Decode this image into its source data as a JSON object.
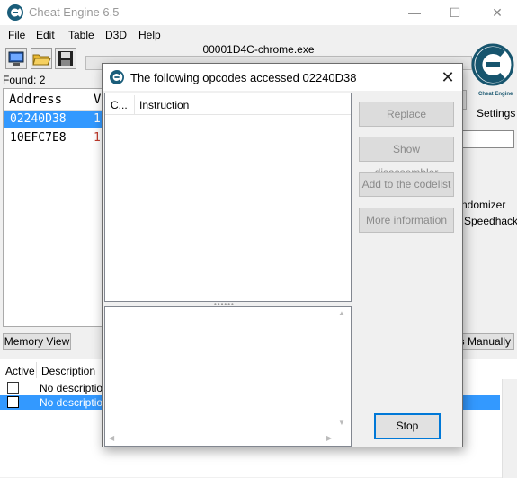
{
  "main_window": {
    "title": "Cheat Engine 6.5",
    "minimize_glyph": "—",
    "maximize_glyph": "☐",
    "close_glyph": "✕",
    "menu": [
      "File",
      "Edit",
      "Table",
      "D3D",
      "Help"
    ],
    "process_name": "00001D4C-chrome.exe",
    "found_label": "Found: 2",
    "columns": {
      "address": "Address",
      "value": "V"
    },
    "rows": [
      {
        "address": "02240D38",
        "value": "1",
        "selected": true
      },
      {
        "address": "10EFC7E8",
        "value": "1",
        "selected": false
      }
    ],
    "settings_label": "Settings",
    "logo_text": "Cheat Engine",
    "randomizer_label": "ndomizer",
    "speedhack_label": "Speedhack",
    "memory_view_button": "Memory View",
    "add_manually_button": "ss Manually",
    "next_scan_partial": "n",
    "bottom_columns": {
      "active": "Active",
      "description": "Description"
    },
    "bottom_rows": [
      {
        "description": "No description",
        "selected": false
      },
      {
        "description": "No description",
        "selected": true
      }
    ],
    "accent_color": "#3399ff",
    "value_color": "#c0392b"
  },
  "dialog": {
    "title": "The following opcodes accessed 02240D38",
    "close_glyph": "✕",
    "columns": {
      "count": "C...",
      "instruction": "Instruction"
    },
    "buttons": {
      "replace": "Replace",
      "show_disassembler": "Show disassembler",
      "add_to_codelist": "Add to the codelist",
      "more_information": "More information",
      "stop": "Stop"
    },
    "splitter_glyph": "••••••",
    "scroll_up": "▲",
    "scroll_down": "▼",
    "scroll_left": "◀",
    "scroll_right": "▶"
  }
}
